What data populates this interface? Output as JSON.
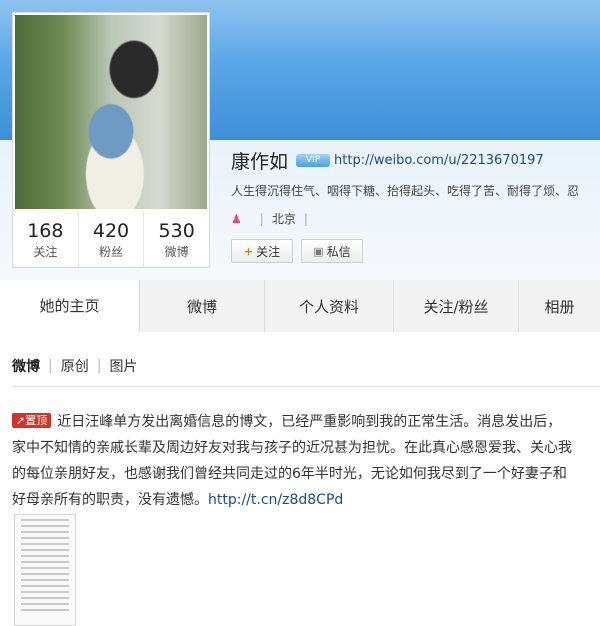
{
  "profile": {
    "name": "康作如",
    "badge": "VIP",
    "url": "http://weibo.com/u/2213670197",
    "bio": "人生得沉得住气、咽得下糖、抬得起头、吃得了苦、耐得了烦、忍",
    "location": "北京",
    "location_sep": "|"
  },
  "stats": [
    {
      "value": "168",
      "label": "关注"
    },
    {
      "value": "420",
      "label": "粉丝"
    },
    {
      "value": "530",
      "label": "微博"
    }
  ],
  "actions": {
    "follow": "关注",
    "follow_icon": "+",
    "message": "私信"
  },
  "tabs": [
    {
      "label": "她的主页"
    },
    {
      "label": "微博"
    },
    {
      "label": "个人资料"
    },
    {
      "label": "关注/粉丝"
    },
    {
      "label": "相册"
    }
  ],
  "subnav": {
    "items": [
      "微博",
      "原创",
      "图片"
    ],
    "sep": "|"
  },
  "post": {
    "tag": "置顶",
    "line1": "近日汪峰单方发出离婚信息的博文，已经严重影响到我的正常生活。消息发出后，",
    "line2": "家中不知情的亲戚长辈及周边好友对我与孩子的近况甚为担忧。在此真心感恩爱我、关心我",
    "line3": "的每位亲朋好友，也感谢我们曾经共同走过的6年半时光，无论如何我尽到了一个好妻子和",
    "line4": "好母亲所有的职责，没有遗憾。",
    "link": "http://t.cn/z8d8CPd"
  },
  "colors": {
    "banner": "#5aa6e6",
    "link": "#1a4c8a",
    "tag": "#d0352b"
  }
}
